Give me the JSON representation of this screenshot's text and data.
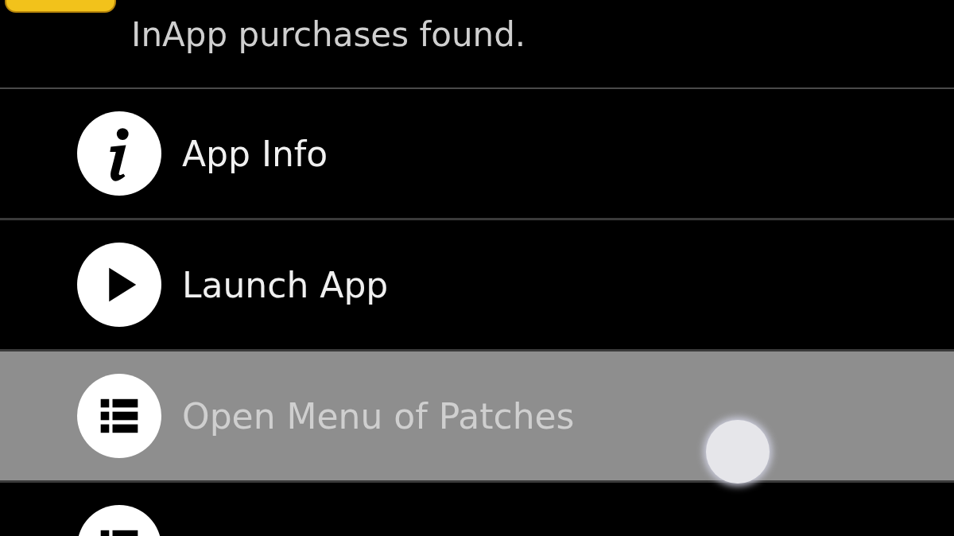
{
  "header": {
    "status_text": "InApp purchases found."
  },
  "menu_items": [
    {
      "kind": "info",
      "label": "App Info",
      "selected": false
    },
    {
      "kind": "play",
      "label": "Launch App",
      "selected": false
    },
    {
      "kind": "list",
      "label": "Open Menu of Patches",
      "selected": true
    },
    {
      "kind": "list",
      "selected": false
    }
  ]
}
